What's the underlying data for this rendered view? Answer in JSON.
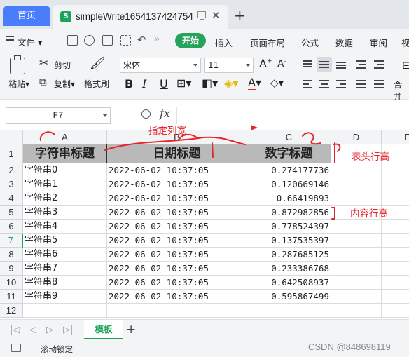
{
  "titlebar": {
    "home_tab": "首页",
    "doc_tab_title": "simpleWrite1654137424754"
  },
  "menubar": {
    "file_label": "文件",
    "start_label": "开始",
    "items": [
      "插入",
      "页面布局",
      "公式",
      "数据",
      "审阅",
      "视"
    ]
  },
  "ribbon": {
    "paste_label": "粘贴",
    "cut_label": "剪切",
    "copy_label": "复制",
    "format_painter_label": "格式刷",
    "font_name": "宋体",
    "font_size": "11",
    "merge_label": "合并"
  },
  "formula_bar": {
    "cell_ref": "F7",
    "fx": "fx",
    "value": ""
  },
  "grid": {
    "columns": [
      "A",
      "B",
      "C",
      "D",
      "E"
    ],
    "rows": [
      "1",
      "2",
      "3",
      "4",
      "5",
      "6",
      "7",
      "8",
      "9",
      "10",
      "11",
      "12"
    ],
    "selected_row": "7",
    "header": [
      "字符串标题",
      "日期标题",
      "数字标题"
    ],
    "data": [
      [
        "字符串0",
        "2022-06-02 10:37:05",
        "0.274177736"
      ],
      [
        "字符串1",
        "2022-06-02 10:37:05",
        "0.120669146"
      ],
      [
        "字符串2",
        "2022-06-02 10:37:05",
        "0.66419893"
      ],
      [
        "字符串3",
        "2022-06-02 10:37:05",
        "0.872982856"
      ],
      [
        "字符串4",
        "2022-06-02 10:37:05",
        "0.778524397"
      ],
      [
        "字符串5",
        "2022-06-02 10:37:05",
        "0.137535397"
      ],
      [
        "字符串6",
        "2022-06-02 10:37:05",
        "0.287685125"
      ],
      [
        "字符串7",
        "2022-06-02 10:37:05",
        "0.233386768"
      ],
      [
        "字符串8",
        "2022-06-02 10:37:05",
        "0.642508937"
      ],
      [
        "字符串9",
        "2022-06-02 10:37:05",
        "0.595867499"
      ]
    ]
  },
  "sheets": {
    "active": "模板"
  },
  "status": {
    "scroll_lock": "滚动锁定",
    "watermark": "CSDN @848698119"
  },
  "annotations": {
    "column_width": "指定列宽",
    "header_row_height": "表头行高",
    "content_row_height": "内容行高"
  },
  "colors": {
    "accent_green": "#1aa35a",
    "home_blue": "#4a7dfc",
    "annotation_red": "#e8242b",
    "header_fill": "#b9b9b9"
  }
}
